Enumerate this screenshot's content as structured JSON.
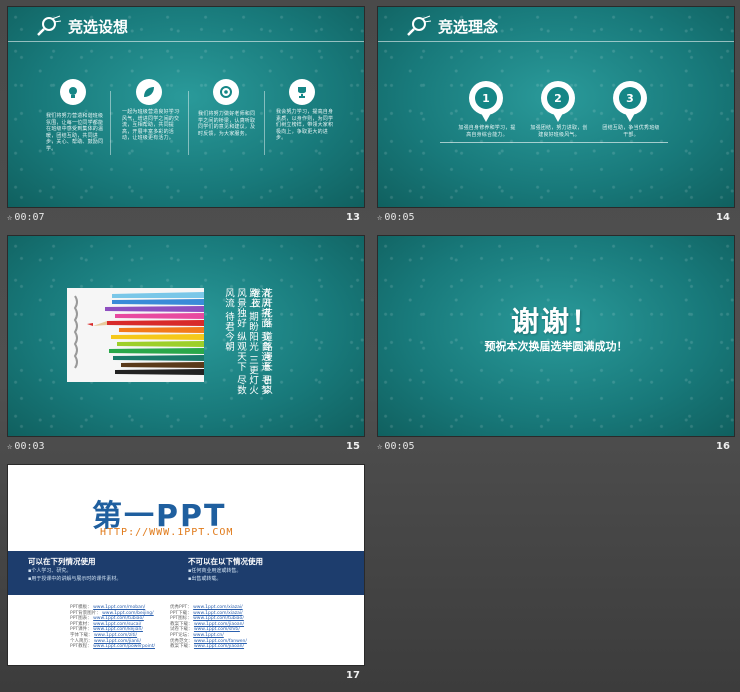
{
  "slides": [
    {
      "number": "13",
      "timing": "00:07",
      "title": "竞选设想",
      "columns": [
        {
          "icon": "lightbulb-icon",
          "text": "我们将努力营造和谐班级氛围，让每一位同学都能在班级中感受到集体的温暖，团结互助，共同进步，关心、帮助、鼓励同学。"
        },
        {
          "icon": "leaf-icon",
          "text": "一起为班级营造良好学习风气，增进同学之间的交流，互相帮助，共同提高，开展丰富多彩的活动，让班级更有活力。"
        },
        {
          "icon": "target-icon",
          "text": "我们将努力做好老师和同学之间的桥梁，认真听取同学们的意见和建议，及时反馈，为大家服务。"
        },
        {
          "icon": "trophy-icon",
          "text": "我会努力学习，提高自身素质，以身作则，为同学们树立榜样，带领大家积极向上，争取更大的进步。"
        }
      ]
    },
    {
      "number": "14",
      "timing": "00:05",
      "title": "竞选理念",
      "pins": [
        {
          "label": "1",
          "text": "加强自身修养和学习，提高自身综合能力。"
        },
        {
          "label": "2",
          "text": "加强团结，努力进取，创建良好班级风气。"
        },
        {
          "label": "3",
          "text": "团结互助，争当优秀班级干部。"
        }
      ]
    },
    {
      "number": "15",
      "timing": "00:03",
      "poem_columns": [
        "清风拂面",
        "我自逍遥",
        "寻梦路上",
        "期盼阳光",
        "三更灯火",
        "风景独好",
        "纵观天下",
        "尽数风流",
        "待君今朝"
      ],
      "poem_columns_b": [
        "花开花落",
        "道路漫长",
        "日以继夜",
        "无限风光",
        "前路漫漫",
        "这边独好",
        "数风流人物",
        "还看今朝",
        "人物河长"
      ]
    },
    {
      "number": "16",
      "timing": "00:05",
      "thanks": "谢谢！",
      "subtitle": "预祝本次换届选举圆满成功！"
    },
    {
      "number": "17",
      "logo_text": "第一PPT",
      "logo_url": "HTTP://WWW.1PPT.COM",
      "can_use_title": "可以在下列情况使用",
      "can_use_items": [
        "个人学习、研究。",
        "用于授课中的讲解与展示时的课件素材。"
      ],
      "cannot_use_title": "不可以在以下情况使用",
      "cannot_use_items": [
        "任何商业用途或转售。",
        "出售或转载。"
      ],
      "links_left": [
        {
          "label": "PPT模板：",
          "url": "www.1ppt.com/moban/"
        },
        {
          "label": "PPT背景图片：",
          "url": "www.1ppt.com/beijing/"
        },
        {
          "label": "PPT图表：",
          "url": "www.1ppt.com/tubiao/"
        },
        {
          "label": "PPT素材：",
          "url": "www.1ppt.com/sucai/"
        },
        {
          "label": "PPT课件：",
          "url": "www.1ppt.com/kejian/"
        },
        {
          "label": "字体下载：",
          "url": "www.1ppt.com/ziti/"
        },
        {
          "label": "个人简历：",
          "url": "www.1ppt.com/jianli/"
        },
        {
          "label": "PPT教程：",
          "url": "www.1ppt.com/powerpoint/"
        }
      ],
      "links_right": [
        {
          "label": "优秀PPT：",
          "url": "www.1ppt.com/xiazai/"
        },
        {
          "label": "PPT下载：",
          "url": "www.1ppt.com/xiazai/"
        },
        {
          "label": "PPT图标：",
          "url": "www.1ppt.com/tubiao/"
        },
        {
          "label": "教案下载：",
          "url": "www.1ppt.com/jiaoan/"
        },
        {
          "label": "试卷下载：",
          "url": "www.1ppt.com/shiti/"
        },
        {
          "label": "PPT论坛：",
          "url": "www.1ppt.cn/"
        },
        {
          "label": "优秀范文：",
          "url": "www.1ppt.com/fanwen/"
        },
        {
          "label": "教案下载：",
          "url": "www.1ppt.com/jiaoan/"
        }
      ]
    }
  ]
}
